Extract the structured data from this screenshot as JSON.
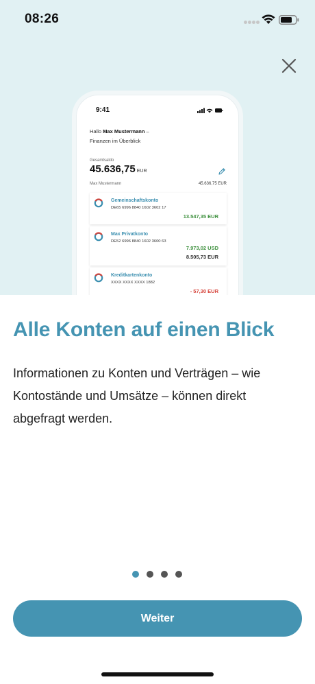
{
  "status_bar": {
    "time": "08:26"
  },
  "onboarding": {
    "headline": "Alle Konten auf einen Blick",
    "body": "Informationen zu Konten und Verträgen – wie Kontostände und Umsätze – können direkt abgefragt werden.",
    "button_label": "Weiter",
    "page_indicator": {
      "total": 4,
      "active": 1
    }
  },
  "phone_mockup": {
    "time": "9:41",
    "greeting_prefix": "Hallo ",
    "greeting_name": "Max Mustermann",
    "greeting_suffix": " –",
    "greeting_line2": "Finanzen im Überblick",
    "total_label": "Gesamtsaldo",
    "total_amount": "45.636,75",
    "total_currency": "EUR",
    "owner_name": "Max Mustermann",
    "owner_total": "45.636,75 EUR",
    "accounts": [
      {
        "name": "Gemeinschaftskonto",
        "iban": "DE65 6996 8840 1602 3602 17",
        "amounts": [
          "13.547,35 EUR"
        ]
      },
      {
        "name": "Max Privatkonto",
        "iban": "DE52 6996 8840 1602 3600 63",
        "amounts": [
          "7.973,02 USD",
          "8.505,73 EUR"
        ]
      },
      {
        "name": "Kreditkartenkonto",
        "iban": "XXXX XXXX XXXX 1882",
        "amounts": [
          "- 57,30 EUR"
        ]
      }
    ]
  },
  "colors": {
    "accent": "#4594b2",
    "top_background": "#e1f1f3",
    "positive": "#3c8f3c",
    "negative": "#d6433a"
  }
}
